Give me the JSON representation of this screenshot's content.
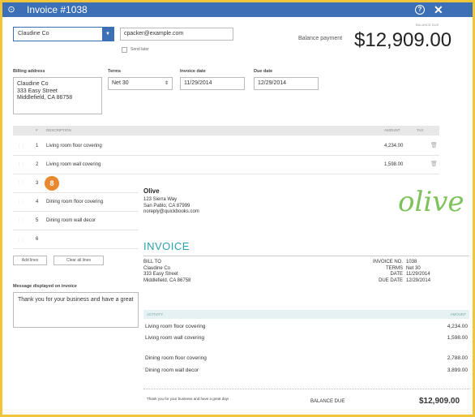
{
  "window": {
    "title": "Invoice #1038"
  },
  "customer": {
    "name": "Claudine Co",
    "email": "cpacker@example.com",
    "send_later": "Send later"
  },
  "balance": {
    "label": "Balance payment",
    "amount": "$12,909.00",
    "small_label": "BALANCE DUE"
  },
  "billing": {
    "label": "Billing address",
    "lines": [
      "Claudine Co",
      "333 Easy Street",
      "Middlefield, CA 86758"
    ]
  },
  "terms": {
    "label": "Terms",
    "value": "Net 30"
  },
  "invoice_date": {
    "label": "Invoice date",
    "value": "11/29/2014"
  },
  "due_date": {
    "label": "Due date",
    "value": "12/29/2014"
  },
  "table": {
    "headers": {
      "num": "#",
      "description": "DESCRIPTION",
      "amount": "AMOUNT",
      "tax": "TAX"
    },
    "rows": [
      {
        "num": "1",
        "desc": "Living room floor covering",
        "amount": "4,234.00"
      },
      {
        "num": "2",
        "desc": "Living room wall covering",
        "amount": "1,598.00"
      },
      {
        "num": "3",
        "desc": "",
        "amount": ""
      },
      {
        "num": "4",
        "desc": "Dining room floor covering",
        "amount": ""
      },
      {
        "num": "5",
        "desc": "Dining room wall decor",
        "amount": ""
      },
      {
        "num": "6",
        "desc": "",
        "amount": ""
      }
    ]
  },
  "badge": "8",
  "buttons": {
    "add_lines": "Add lines",
    "clear_lines": "Clear all lines"
  },
  "memo": {
    "label": "Message displayed on invoice",
    "value": "Thank you for your business and have a great"
  },
  "doc": {
    "company": "Olive",
    "address": [
      "123 Sierra Way",
      "San Pablo, CA 87999",
      "noreply@quickbooks.com"
    ],
    "logo_text": "olive",
    "title": "INVOICE",
    "bill_to": [
      "BILL TO",
      "Claudine Co",
      "333 Easy Street",
      "Middlefield, CA 86758"
    ],
    "meta": [
      {
        "k": "INVOICE NO.",
        "v": "1038"
      },
      {
        "k": "TERMS",
        "v": "Net 30"
      },
      {
        "k": "DATE",
        "v": "11/29/2014"
      },
      {
        "k": "DUE DATE",
        "v": "12/29/2014"
      }
    ],
    "headers": {
      "activity": "ACTIVITY",
      "amount": "AMOUNT"
    },
    "items": [
      {
        "d": "Living room floor covering",
        "a": "4,234.00"
      },
      {
        "d": "Living room wall covering",
        "a": "1,598.00"
      },
      {
        "d": "Dining room floor covering",
        "a": "2,788.00"
      },
      {
        "d": "Dining room wall decor",
        "a": "3,899.00"
      }
    ],
    "thanks": "Thank you for your business and have a great day!",
    "balance_due_label": "BALANCE DUE",
    "balance_due": "$12,909.00"
  },
  "colors": {
    "titlebar": "#3b6fb6",
    "accent_teal": "#2a9fb0",
    "logo_green": "#7dc25a",
    "badge": "#e8892f",
    "border": "#f0c53a"
  }
}
